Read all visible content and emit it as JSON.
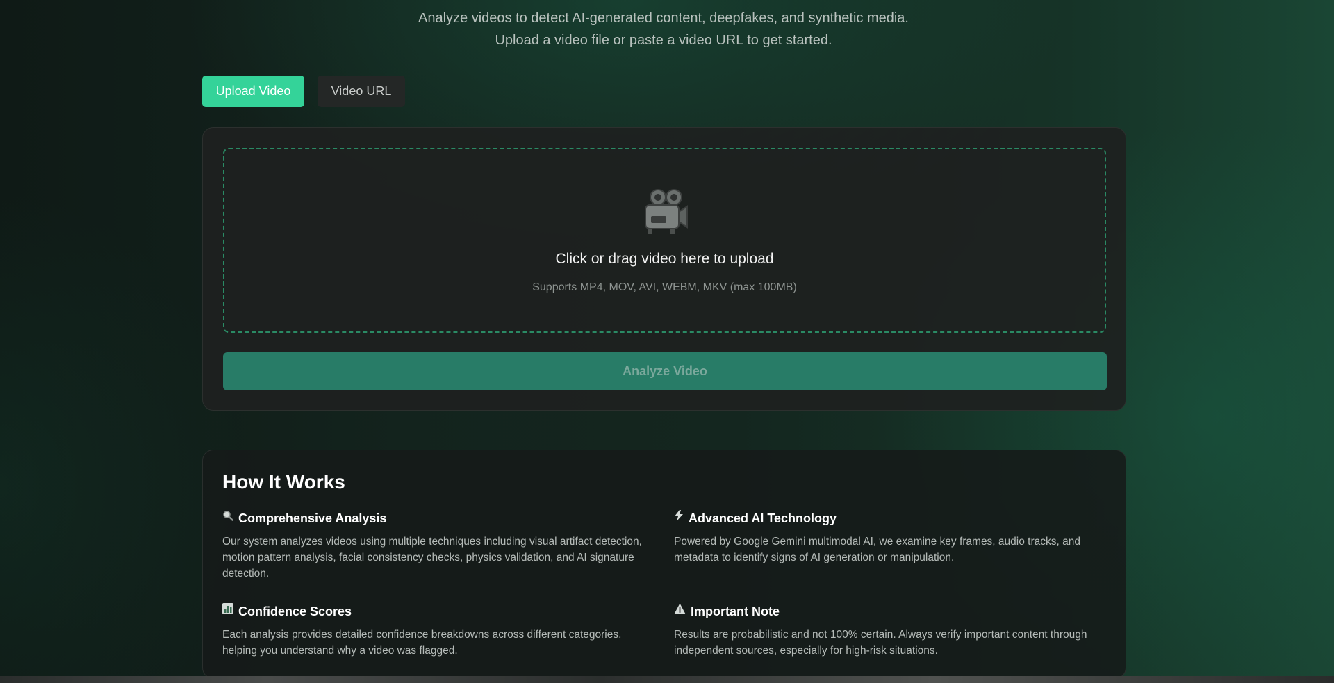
{
  "header": {
    "subtitle_line1": "Analyze videos to detect AI-generated content, deepfakes, and synthetic media.",
    "subtitle_line2": "Upload a video file or paste a video URL to get started."
  },
  "tabs": [
    {
      "label": "Upload Video",
      "active": true
    },
    {
      "label": "Video URL",
      "active": false
    }
  ],
  "upload": {
    "icon": "movie-camera-icon",
    "title": "Click or drag video here to upload",
    "subtitle": "Supports MP4, MOV, AVI, WEBM, MKV (max 100MB)",
    "analyze_label": "Analyze Video"
  },
  "how_it_works": {
    "title": "How It Works",
    "features": [
      {
        "icon": "magnifier-icon",
        "title": "Comprehensive Analysis",
        "text": "Our system analyzes videos using multiple techniques including visual artifact detection, motion pattern analysis, facial consistency checks, physics validation, and AI signature detection."
      },
      {
        "icon": "lightning-icon",
        "title": "Advanced AI Technology",
        "text": "Powered by Google Gemini multimodal AI, we examine key frames, audio tracks, and metadata to identify signs of AI generation or manipulation."
      },
      {
        "icon": "bar-chart-icon",
        "title": "Confidence Scores",
        "text": "Each analysis provides detailed confidence breakdowns across different categories, helping you understand why a video was flagged."
      },
      {
        "icon": "warning-icon",
        "title": "Important Note",
        "text": "Results are probabilistic and not 100% certain. Always verify important content through independent sources, especially for high-risk situations."
      }
    ]
  },
  "colors": {
    "accent": "#34d399",
    "analyze_button": "#287c67",
    "dropzone_border": "#2a8a64"
  }
}
